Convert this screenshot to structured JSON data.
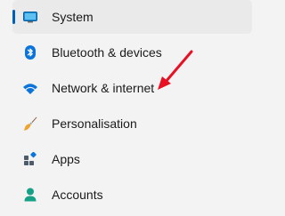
{
  "nav": {
    "items": [
      {
        "label": "System",
        "icon": "system-icon",
        "selected": true
      },
      {
        "label": "Bluetooth & devices",
        "icon": "bluetooth-icon",
        "selected": false
      },
      {
        "label": "Network & internet",
        "icon": "wifi-icon",
        "selected": false
      },
      {
        "label": "Personalisation",
        "icon": "paintbrush-icon",
        "selected": false
      },
      {
        "label": "Apps",
        "icon": "apps-icon",
        "selected": false
      },
      {
        "label": "Accounts",
        "icon": "user-icon",
        "selected": false
      }
    ]
  },
  "colors": {
    "accent": "#005fb8",
    "annotation_arrow": "#e81123",
    "background": "#f3f3f3",
    "selected_background": "#eaeaea"
  }
}
